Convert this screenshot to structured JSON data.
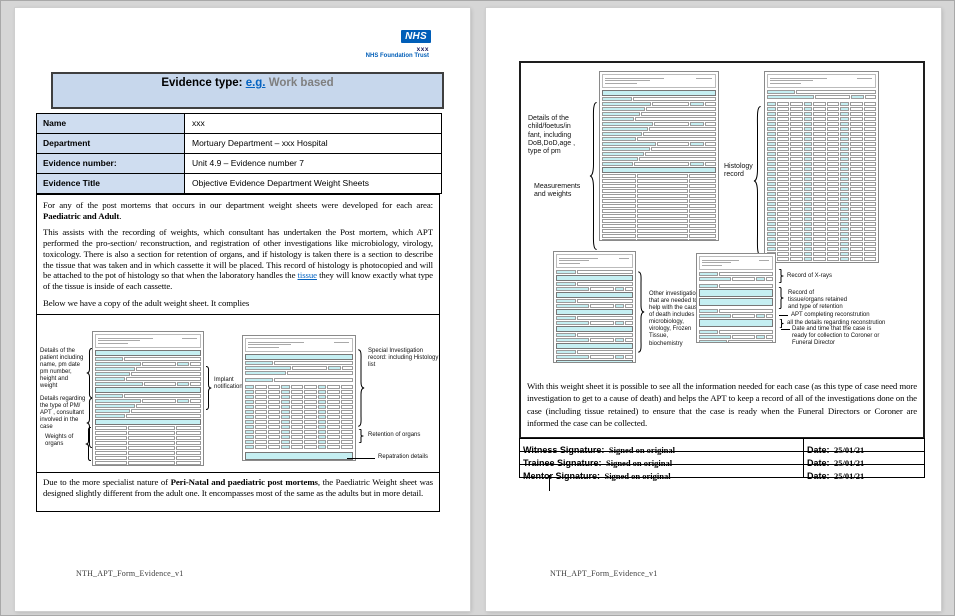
{
  "colors": {
    "nhs_blue": "#005EB8",
    "header_fill": "#c7d7ec",
    "table_label_fill": "#cfddf0",
    "form_cyan": "#c5eff2",
    "link_blue": "#0563C1",
    "muted_gray": "#7f7f7f"
  },
  "page1": {
    "logo": {
      "nhs": "NHS",
      "org": "xxx",
      "trust": "NHS Foundation Trust"
    },
    "evidence_type": {
      "prefix": "Evidence type: ",
      "link": "e.g.",
      "value": " Work based"
    },
    "meta_table": {
      "rows": [
        {
          "label": "Name",
          "value": "xxx"
        },
        {
          "label": "Department",
          "value": "Mortuary Department – xxx Hospital"
        },
        {
          "label": "Evidence number:",
          "value": "Unit 4.9 – Evidence number 7"
        },
        {
          "label": "Evidence Title",
          "value": "Objective Evidence Department Weight Sheets"
        }
      ]
    },
    "paragraphs": {
      "p1_pre": "For any of the post mortems that occurs in our department weight sheets were developed for each area: ",
      "p1_bold": "Paediatric and Adult",
      "p1_post": ".",
      "p2_pre": "This assists with the recording of weights, which consultant has undertaken the Post mortem, which APT performed the pro-section/ reconstruction, and registration of other investigations like microbiology, virology, toxicology. There is also a section for retention of organs, and if histology is taken there is a section to describe the tissue that was taken and in which cassette it will be placed. This record of histology is photocopied and will be attached to the pot of histology so that when the laboratory handles the ",
      "p2_link": "tissue",
      "p2_post": " they will know exactly what type of the tissue is inside of each cassette.",
      "p3": "Below we have a copy of the adult weight sheet. It complies",
      "p4_pre": "Due to the more specialist nature of ",
      "p4_bold": "Peri-Natal and paediatric post mortems",
      "p4_post": ", the Paediatric Weight sheet was designed slightly different from the adult one. It encompasses most of the same as the adults but in more detail."
    },
    "figure": {
      "annotations": {
        "patient_details": "Details of the patient including name, pm date pm number, height and weight",
        "pm_type": "Details regarding the type of PM/ APT , consultant involved in the case",
        "organ_weights": "Weights of organs",
        "implant": "Implant notification",
        "special_investigation": "Special Investigation record: including  Histology list",
        "retention": "Retention of organs",
        "repatriation": "Repatration details"
      }
    },
    "footer": "NTH_APT_Form_Evidence_v1"
  },
  "page2": {
    "figure": {
      "annotations": {
        "child_details": "Details of the child/foetus/in fant, including DoB,DoD,age , type of pm",
        "measurements": "Measurements and weights",
        "histology": "Histology record",
        "other_investigations": "Other investigations that are needed to help with the cause of death includes microbiology, virology, Frozen Tissue, biochemistry",
        "xrays": "Record of X-rays",
        "tissue_retained": "Record of tissue/organs retained and type of retention",
        "apt_reconstruction": "APT completing reconstrution",
        "reconstruction_details": "all the details regarding reconstrution",
        "collection": "Date and time that the case is ready for collection to Coroner or Funeral Director"
      }
    },
    "paragraph": "With this weight sheet it is possible to see all the information needed for each case (as this type of case need more investigation to get to a cause of death) and helps the APT to keep a record of all of the investigations done on the case (including tissue retained) to ensure that the case is ready when the Funeral Directors or Coroner are informed the case can be collected.",
    "signature_table": {
      "rows": [
        {
          "label": "Witness Signature:",
          "value": "Signed on original",
          "date_label": "Date:",
          "date": "25/01/21"
        },
        {
          "label": "Trainee Signature:",
          "value": "Signed on original",
          "date_label": "Date:",
          "date": "25/01/21"
        },
        {
          "label": "Mentor Signature:",
          "value": "Signed on original",
          "date_label": "Date:",
          "date": "25/01/21"
        }
      ]
    },
    "footer": "NTH_APT_Form_Evidence_v1"
  }
}
